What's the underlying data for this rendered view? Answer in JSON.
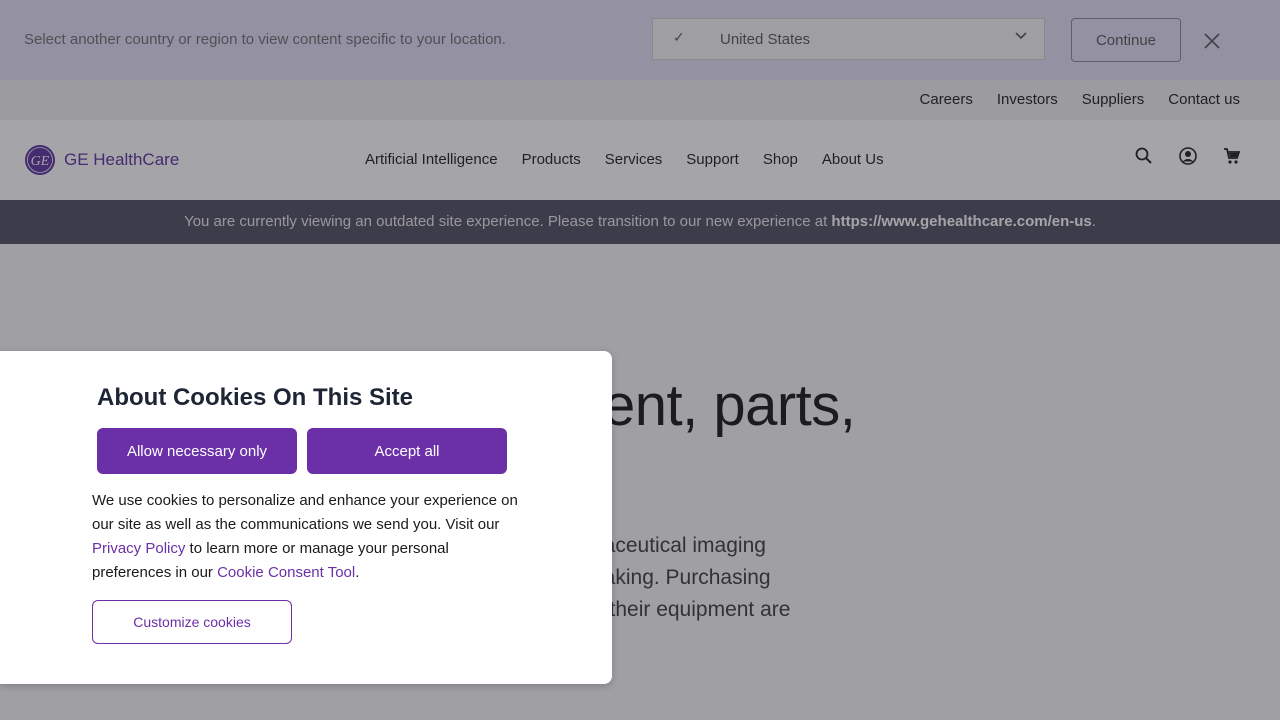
{
  "country_bar": {
    "message": "Select another country or region to view content specific to your location.",
    "selected_country": "United States",
    "continue_label": "Continue"
  },
  "utility_nav": [
    "Careers",
    "Investors",
    "Suppliers",
    "Contact us"
  ],
  "brand": {
    "logo_monogram": "GE",
    "name": "GE HealthCare",
    "color": "#5a2d9c"
  },
  "main_nav": [
    "Artificial Intelligence",
    "Products",
    "Services",
    "Support",
    "Shop",
    "About Us"
  ],
  "nav_icons": [
    "search-icon",
    "account-icon",
    "cart-icon"
  ],
  "notice": {
    "text": "You are currently viewing an outdated site experience. Please transition to our new experience at ",
    "link": "https://www.gehealthcare.com/en-us",
    "suffix": "."
  },
  "hero": {
    "title_visible": "ent, parts,",
    "text_lines": [
      "naceutical imaging",
      "naking. Purchasing",
      "d their equipment are"
    ]
  },
  "cookie": {
    "title": "About Cookies On This Site",
    "allow_necessary_label": "Allow necessary only",
    "accept_all_label": "Accept all",
    "body_1": "We use cookies to personalize and enhance your experience on our site as well as the communications we send you. Visit our ",
    "privacy_link": "Privacy Policy",
    "body_2": " to learn more or manage your personal preferences in our ",
    "consent_link": "Cookie Consent Tool",
    "body_3": ".",
    "customize_label": "Customize cookies"
  },
  "colors": {
    "accent": "#6b2fa7",
    "notice_bg": "#4a4a5c",
    "country_bar_bg": "#e2dcf5"
  }
}
